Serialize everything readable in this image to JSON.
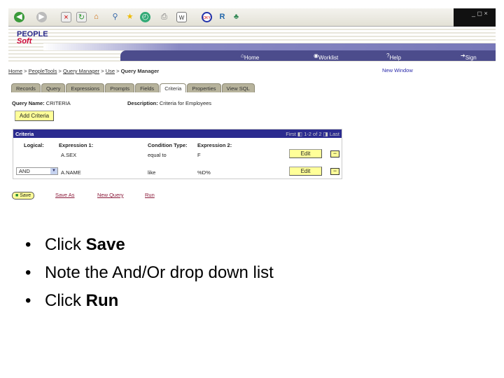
{
  "header": {
    "logo": "PeopleSoft",
    "nav": [
      "Home",
      "Worklist",
      "Help",
      "Sign Out"
    ]
  },
  "breadcrumb": {
    "items": [
      "Home",
      "PeopleTools",
      "Query Manager",
      "Use"
    ],
    "current": "Query Manager",
    "new_window": "New Window"
  },
  "tabs": [
    "Records",
    "Query",
    "Expressions",
    "Prompts",
    "Fields",
    "Criteria",
    "Properties",
    "View SQL"
  ],
  "query": {
    "name_label": "Query Name:",
    "name": "CRITERIA",
    "desc_label": "Description:",
    "desc": "Criteria for Employees",
    "add_button": "Add Criteria"
  },
  "grid": {
    "title": "Criteria",
    "nav": {
      "first": "First",
      "range": "1-2 of 2",
      "last": "Last"
    },
    "headers": [
      "Logical:",
      "Expression 1:",
      "Condition Type:",
      "Expression 2:"
    ],
    "rows": [
      {
        "logical": "",
        "expr1": "A.SEX",
        "cond": "equal to",
        "expr2": "F",
        "edit": "Edit"
      },
      {
        "logical": "AND",
        "expr1": "A.NAME",
        "cond": "like",
        "expr2": "%D%",
        "edit": "Edit"
      }
    ]
  },
  "actions": {
    "save": "Save",
    "save_as": "Save As",
    "new_query": "New Query",
    "run": "Run"
  },
  "bullets": [
    {
      "pre": "Click ",
      "bold": "Save",
      "post": ""
    },
    {
      "pre": "Note the And/Or drop down list",
      "bold": "",
      "post": ""
    },
    {
      "pre": "Click ",
      "bold": "Run",
      "post": ""
    }
  ]
}
